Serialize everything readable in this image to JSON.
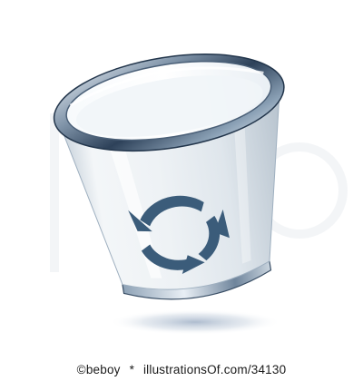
{
  "credit": {
    "author": "©beboy",
    "separator": "*",
    "site": "illustrationsOf.com/34130"
  },
  "colors": {
    "rim_dark": "#2c3f57",
    "rim_light": "#dce6f0",
    "glass_body": "#eef3f7",
    "recycle_symbol": "#3b5c7a",
    "shadow": "#b9c6d6"
  },
  "icons": [
    "trash-bin-icon",
    "recycle-arrows-icon"
  ]
}
